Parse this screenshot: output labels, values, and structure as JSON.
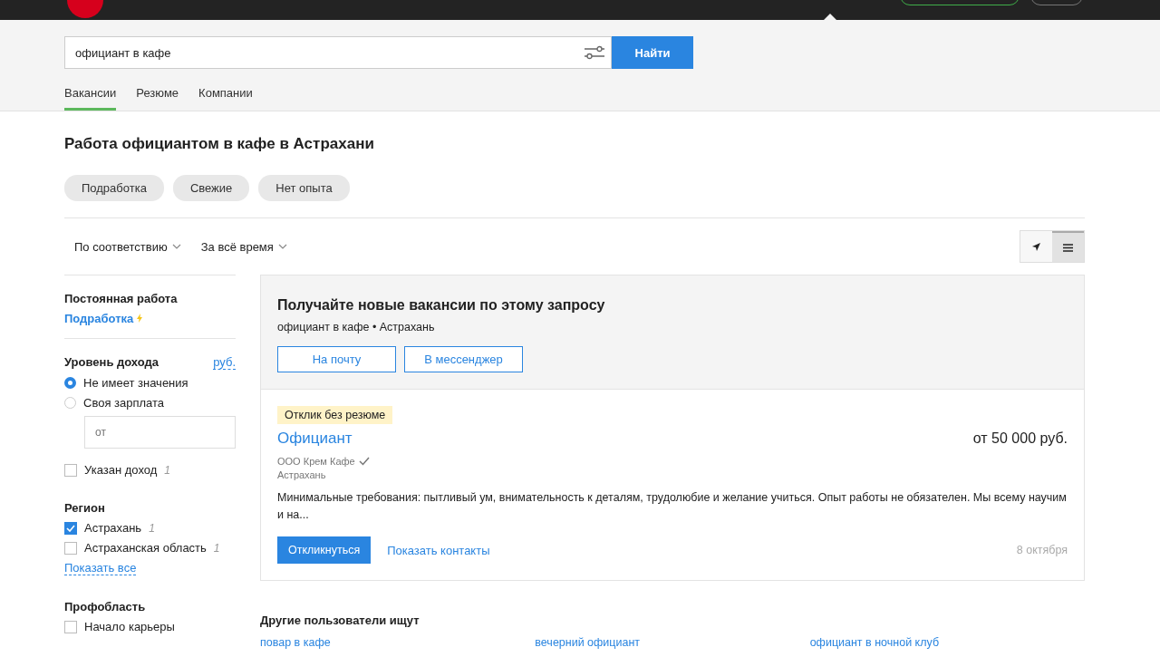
{
  "search": {
    "value": "официант в кафе",
    "button": "Найти"
  },
  "tabs": [
    {
      "label": "Вакансии",
      "selected": true
    },
    {
      "label": "Резюме",
      "selected": false
    },
    {
      "label": "Компании",
      "selected": false
    }
  ],
  "page_title": "Работа официантом в кафе в Астрахани",
  "quick_filters": [
    "Подработка",
    "Свежие",
    "Нет опыта"
  ],
  "sort": [
    "По соответствию",
    "За всё время"
  ],
  "view_toggle": [
    {
      "kind": "map",
      "selected": false
    },
    {
      "kind": "list",
      "selected": true
    }
  ],
  "sidebar": {
    "employment": {
      "title": "Постоянная работа",
      "link": "Подработка"
    },
    "income": {
      "title": "Уровень дохода",
      "currency": "руб.",
      "options": [
        {
          "label": "Не имеет значения",
          "selected": true
        },
        {
          "label": "Своя зарплата",
          "selected": false
        }
      ],
      "placeholder": "от",
      "checkbox": {
        "label": "Указан доход",
        "count": "1",
        "checked": false
      }
    },
    "region": {
      "title": "Регион",
      "items": [
        {
          "label": "Астрахань",
          "count": "1",
          "checked": true
        },
        {
          "label": "Астраханская область",
          "count": "1",
          "checked": false
        }
      ],
      "show_all": "Показать все"
    },
    "profarea": {
      "title": "Профобласть",
      "items": [
        {
          "label": "Начало карьеры",
          "checked": false
        }
      ]
    }
  },
  "subscribe": {
    "title": "Получайте новые вакансии по этому запросу",
    "query": "официант в кафе • Астрахань",
    "buttons": [
      "На почту",
      "В мессенджер"
    ]
  },
  "vacancy": {
    "badge": "Отклик без резюме",
    "title": "Официант",
    "salary": "от 50 000 руб.",
    "company": "ООО Крем Кафе",
    "verified": true,
    "city": "Астрахань",
    "description": "Минимальные требования: пытливый ум, внимательность к деталям, трудолюбие и желание учиться. Опыт работы не обязателен. Мы всему научим и на...",
    "apply": "Откликнуться",
    "contacts": "Показать контакты",
    "date": "8 октября"
  },
  "related": {
    "title": "Другие пользователи ищут",
    "links": [
      "повар в кафе",
      "вечерний официант",
      "официант в ночной клуб"
    ]
  }
}
